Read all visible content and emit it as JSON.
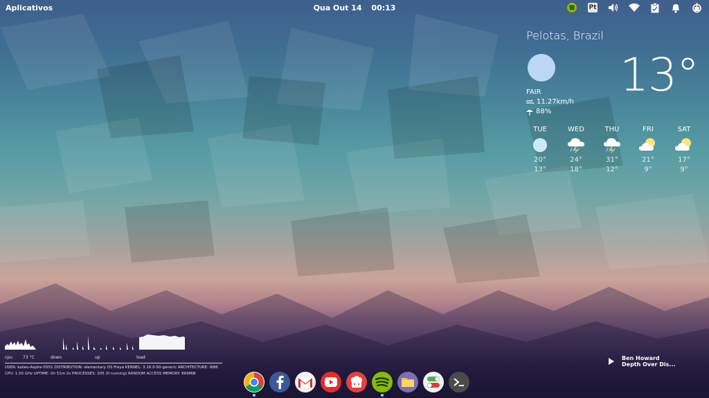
{
  "panel": {
    "apps_label": "Aplicativos",
    "date": "Qua Out 14",
    "time": "00:13",
    "indicator_pt": "Pt"
  },
  "weather": {
    "city": "Pelotas, Brazil",
    "temperature": "13°",
    "condition": "FAIR",
    "wind": "11.27km/h",
    "humidity": "88%",
    "forecast": [
      {
        "day": "TUE",
        "high": "20°",
        "low": "13°",
        "icon": "sun-icon"
      },
      {
        "day": "WED",
        "high": "24°",
        "low": "18°",
        "icon": "thunderstorm-icon"
      },
      {
        "day": "THU",
        "high": "31°",
        "low": "12°",
        "icon": "thunderstorm-icon"
      },
      {
        "day": "FRI",
        "high": "21°",
        "low": "9°",
        "icon": "partly-cloudy-icon"
      },
      {
        "day": "SAT",
        "high": "17°",
        "low": "9°",
        "icon": "partly-cloudy-icon"
      }
    ]
  },
  "conky": {
    "cpu_label": "cpu",
    "cpu_temp": "73 °C",
    "down_label": "down",
    "up_label": "up",
    "load_label": "load",
    "row1": "USER: kalieu-Aspire-5551   DISTRIBUTION: elementary OS Freya   KERNEL: 3.16.0-50-generic   ARCHITECTURE: i686",
    "row2": "CPU: 1.50 GHz   UPTIME: 0h 51m 2s   PROCESSES: 205 (0 running)   RANDOM ACCESS MEMORY: 869MiB"
  },
  "music": {
    "artist": "Ben Howard",
    "track": "Depth Over Dis..."
  },
  "dock": [
    {
      "name": "chrome-icon",
      "color": "#ffffff",
      "running": true
    },
    {
      "name": "facebook-icon",
      "color": "#3b5998",
      "running": false
    },
    {
      "name": "gmail-icon",
      "color": "#f1f1f1",
      "running": false
    },
    {
      "name": "youtube-icon",
      "color": "#e52d27",
      "running": false
    },
    {
      "name": "popcorn-icon",
      "color": "#e0433f",
      "running": false
    },
    {
      "name": "spotify-icon",
      "color": "#84bd00",
      "running": true
    },
    {
      "name": "files-icon",
      "color": "#7b6fb5",
      "running": false
    },
    {
      "name": "settings-icon",
      "color": "#f2f2f2",
      "running": false
    },
    {
      "name": "terminal-icon",
      "color": "#4b4b4b",
      "running": false
    }
  ]
}
